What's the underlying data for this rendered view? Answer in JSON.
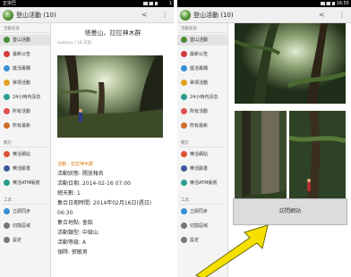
{
  "status_bar": {
    "left_text": "正宗巴",
    "time_left": "1",
    "right_text": "",
    "time_right": "16:55"
  },
  "app": {
    "title": "登山活動 (10)",
    "icon": "mountain-icon",
    "share_icon": "share-icon",
    "overflow_icon": "overflow-menu-icon"
  },
  "drawer": {
    "section_main": "活動訊息",
    "section_other": "關於",
    "section_tools": "工具",
    "items": [
      {
        "label": "登山活動",
        "icon": "mountain-icon",
        "color": "#4a8c3a",
        "active": true
      },
      {
        "label": "最新公告",
        "icon": "announcement-icon",
        "color": "#d63a3a",
        "active": false
      },
      {
        "label": "獎活專欄",
        "icon": "bike-icon",
        "color": "#3a8fd6",
        "active": false
      },
      {
        "label": "單項活動",
        "icon": "event-icon",
        "color": "#e0a020",
        "active": false
      },
      {
        "label": "24小時內訊息",
        "icon": "clock-icon",
        "color": "#2a9d8f",
        "active": false
      },
      {
        "label": "所有活動",
        "icon": "list-icon",
        "color": "#e05050",
        "active": false
      },
      {
        "label": "所有最新",
        "icon": "star-icon",
        "color": "#d07030",
        "active": false
      }
    ],
    "other_items": [
      {
        "label": "樂活網站",
        "icon": "web-icon",
        "color": "#e05030"
      },
      {
        "label": "樂活臉書",
        "icon": "facebook-icon",
        "color": "#3b5998"
      },
      {
        "label": "樂活ATM帳號",
        "icon": "atm-icon",
        "color": "#2a9d8f"
      }
    ],
    "tool_items": [
      {
        "label": "立即同步",
        "icon": "sync-icon",
        "color": "#3a8fd6"
      },
      {
        "label": "切換區域",
        "icon": "region-icon",
        "color": "#777777"
      },
      {
        "label": "設定",
        "icon": "settings-icon",
        "color": "#777777"
      }
    ]
  },
  "detail": {
    "title": "塔曼山、拉拉神木群",
    "meta": "outdoor / 18 天前",
    "highlight": "活動 - 拉拉神木群",
    "info_lines": [
      "活動狀態: 開放報名",
      "活動日期: 2014-02-16 07:00",
      "總天數: 1",
      "集合日期時間: 2014年02月16日(週日)",
      "06:30",
      "集合地點: 會館",
      "活動類型: 中級山",
      "活動等級: A",
      "領隊: 張敏男"
    ]
  },
  "right_screen": {
    "visit_button": "訪問網站"
  },
  "colors": {
    "accent_orange": "#d9780b",
    "arrow_yellow": "#f5e000"
  }
}
